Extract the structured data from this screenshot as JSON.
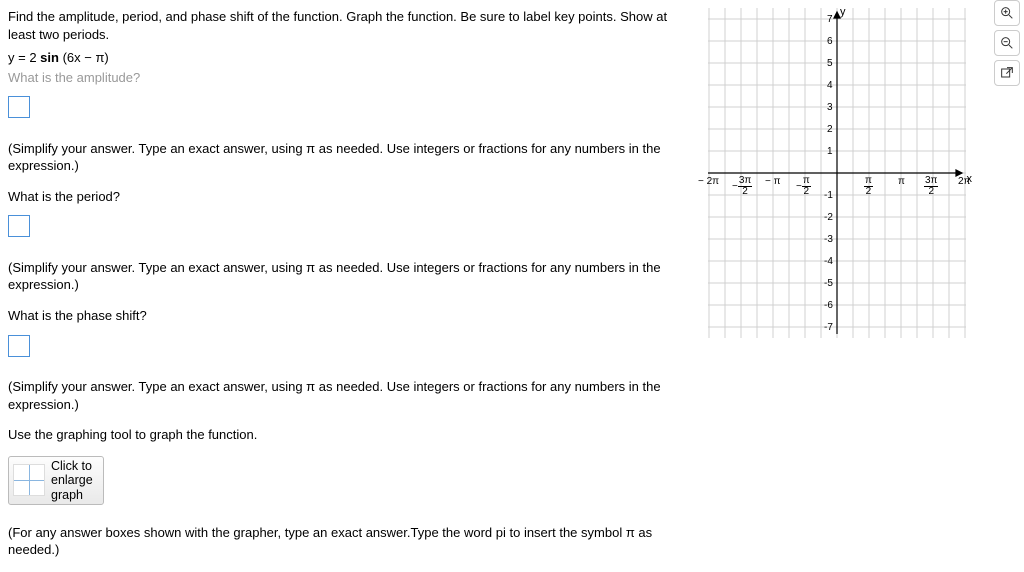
{
  "problem": {
    "instruction": "Find the amplitude, period, and phase shift of the function. Graph the function. Be sure to label key points. Show at least two periods.",
    "equation": "y = 2 sin (6x − π)",
    "amplitude_q_truncated": "What is the amplitude?",
    "amplitude_hint": "(Simplify your answer. Type an exact answer, using π as needed. Use integers or fractions for any numbers in the expression.)",
    "period_q": "What is the period?",
    "period_hint": "(Simplify your answer. Type an exact answer, using π as needed. Use integers or fractions for any numbers in the expression.)",
    "phase_q": "What is the phase shift?",
    "phase_hint": "(Simplify your answer. Type an exact answer, using π as needed. Use integers or fractions for any numbers in the expression.)",
    "graph_instruction": "Use the graphing tool to graph the function.",
    "graph_button": "Click to\nenlarge\ngraph",
    "grapher_hint": "(For any answer boxes shown with the grapher, type an exact answer.Type the word pi to insert the symbol π as needed.)"
  },
  "chart_data": {
    "type": "line",
    "title": "",
    "xlabel": "x",
    "ylabel": "y",
    "xlim": [
      "-2π",
      "2π"
    ],
    "ylim": [
      -7,
      7
    ],
    "x_ticks": [
      "-2π",
      "-3π/2",
      "-π",
      "-π/2",
      "π/2",
      "π",
      "3π/2",
      "2π"
    ],
    "y_ticks": [
      -7,
      -6,
      -5,
      -4,
      -3,
      -2,
      -1,
      1,
      2,
      3,
      4,
      5,
      6,
      7
    ],
    "series": []
  },
  "toolbar": {
    "zoom_in": "zoom-in",
    "zoom_out": "zoom-out",
    "open_external": "open-new-window"
  }
}
